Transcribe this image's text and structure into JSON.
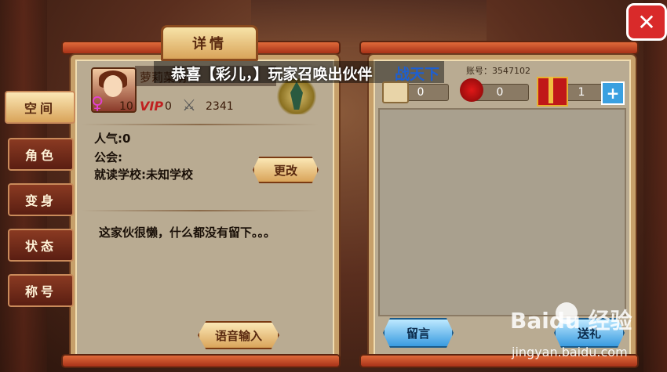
{
  "panel_title": "详情",
  "close_label": "✕",
  "side_tabs": [
    {
      "label": "空间",
      "active": true
    },
    {
      "label": "角色",
      "active": false
    },
    {
      "label": "变身",
      "active": false
    },
    {
      "label": "状态",
      "active": false
    },
    {
      "label": "称号",
      "active": false
    }
  ],
  "player": {
    "name": "萝莉菜萌",
    "level": "10",
    "vip_label": "VIP",
    "vip_level": "0",
    "power": "2341"
  },
  "info": {
    "popularity": "人气:0",
    "guild": "公会:",
    "school": "就读学校:未知学校"
  },
  "change_button": "更改",
  "signature": "这家伙很懒，什么都没有留下。。。",
  "voice_input_button": "语音输入",
  "announcement": {
    "text": "恭喜【彩儿，】玩家召唤出伙伴",
    "highlight": "战天下"
  },
  "account_label": "账号：3547102",
  "stats": {
    "scroll": "0",
    "rose": "0",
    "gift": "1"
  },
  "plus_label": "+",
  "message_button": "留言",
  "send_button": "送礼",
  "watermark": {
    "brand": "Baidu 经验",
    "url": "jingyan.baidu.com"
  },
  "colors": {
    "panel_bg": "#b9ab92",
    "frame": "#c7a06a",
    "vip": "#c02020",
    "announce_link": "#1e5fd0",
    "close": "#d92a2a"
  },
  "icons": [
    "close-icon",
    "female-icon",
    "sword-icon",
    "emblem-icon",
    "scroll-icon",
    "rose-icon",
    "gift-icon",
    "plus-icon"
  ]
}
